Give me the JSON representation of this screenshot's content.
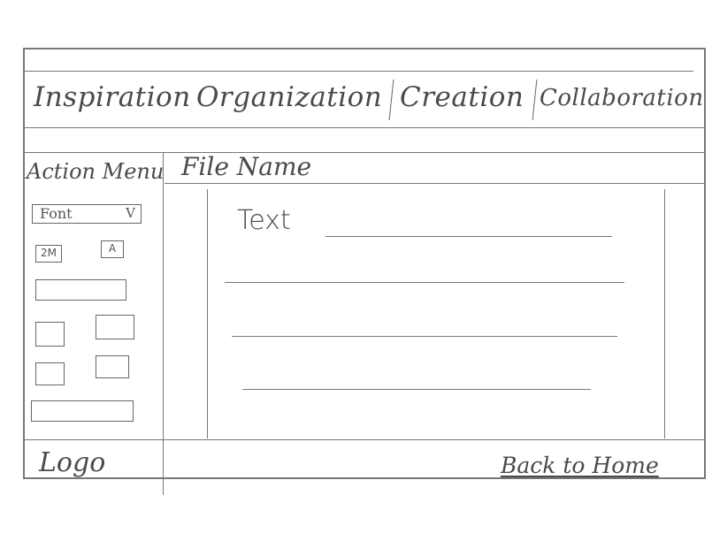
{
  "nav": {
    "tabs": [
      {
        "label": "Inspiration"
      },
      {
        "label": "Organization"
      },
      {
        "label": "Creation"
      },
      {
        "label": "Collaboration"
      }
    ]
  },
  "action_menu": {
    "title": "Action Menu",
    "font_select": {
      "label": "Font",
      "chevron": "V"
    },
    "small_buttons": [
      {
        "label": "2M"
      },
      {
        "label": "A"
      }
    ]
  },
  "editor": {
    "file_name": "File Name",
    "text_label": "Text"
  },
  "footer": {
    "logo": "Logo",
    "back_home": "Back to Home"
  }
}
